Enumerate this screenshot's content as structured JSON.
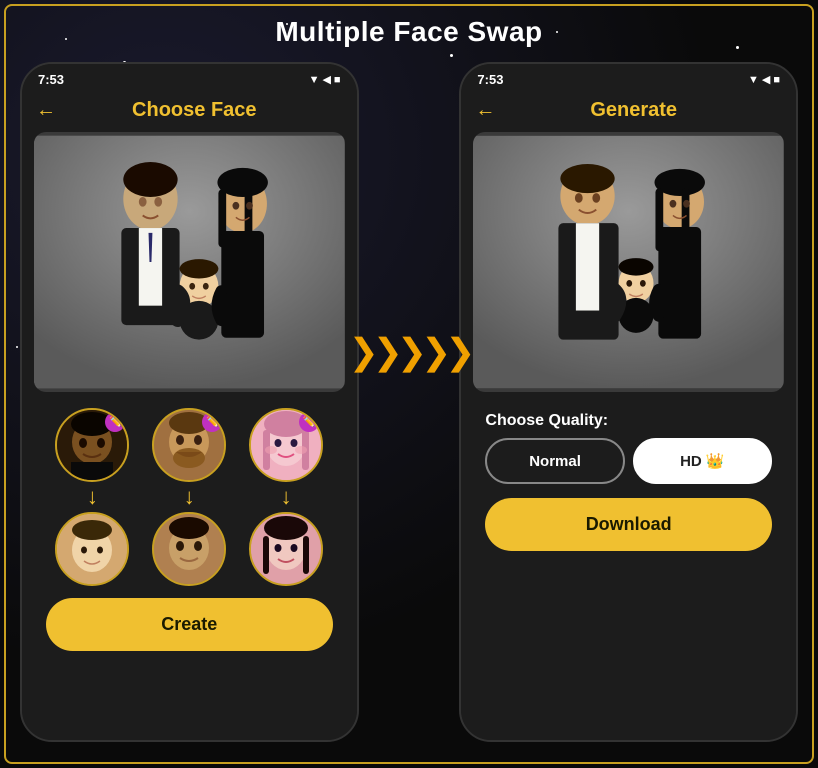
{
  "page": {
    "title": "Multiple Face Swap",
    "background_color": "#0a0a0a"
  },
  "left_phone": {
    "status_bar": {
      "time": "7:53",
      "icons": [
        "▼",
        "◀",
        "■"
      ]
    },
    "header": {
      "back_label": "←",
      "title": "Choose Face"
    },
    "create_button": "Create",
    "face_pairs": [
      {
        "id": "pair1",
        "top_face": "man1",
        "bottom_face": "baby"
      },
      {
        "id": "pair2",
        "top_face": "man2",
        "bottom_face": "youngman"
      },
      {
        "id": "pair3",
        "top_face": "woman",
        "bottom_face": "youngwoman"
      }
    ]
  },
  "right_phone": {
    "status_bar": {
      "time": "7:53",
      "icons": [
        "▼",
        "◀",
        "■"
      ]
    },
    "header": {
      "back_label": "←",
      "title": "Generate"
    },
    "quality_section": {
      "label": "Choose Quality:",
      "options": [
        {
          "id": "normal",
          "label": "Normal",
          "selected": false
        },
        {
          "id": "hd",
          "label": "HD 👑",
          "selected": true
        }
      ]
    },
    "download_button": "Download"
  },
  "arrows": "❯❯❯❯❯"
}
